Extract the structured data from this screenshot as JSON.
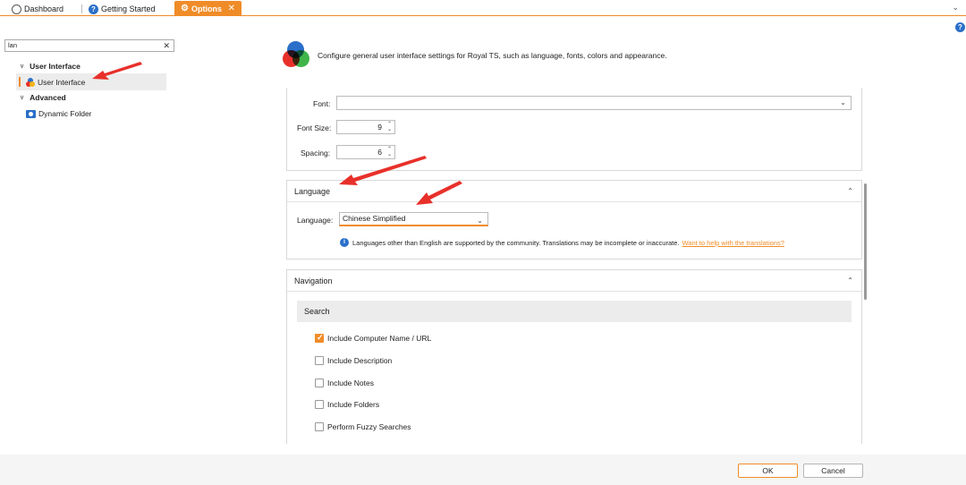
{
  "tabs": {
    "dashboard": "Dashboard",
    "getting_started": "Getting Started",
    "options": "Options"
  },
  "sidebar": {
    "search_value": "lan",
    "groups": [
      {
        "label": "User Interface",
        "items": [
          {
            "label": "User Interface",
            "selected": true
          }
        ]
      },
      {
        "label": "Advanced",
        "items": [
          {
            "label": "Dynamic Folder",
            "selected": false
          }
        ]
      }
    ]
  },
  "header": {
    "description": "Configure general user interface settings for Royal TS, such as language, fonts, colors and appearance."
  },
  "font_section": {
    "font_label": "Font:",
    "font_value": "",
    "font_size_label": "Font Size:",
    "font_size_value": "9",
    "spacing_label": "Spacing:",
    "spacing_value": "6"
  },
  "language_section": {
    "title": "Language",
    "language_label": "Language:",
    "language_value": "Chinese Simplified",
    "info_text": "Languages other than English are supported by the community. Translations may be incomplete or inaccurate.",
    "info_link": "Want to help with the translations?"
  },
  "navigation_section": {
    "title": "Navigation",
    "search_header": "Search",
    "checkboxes": [
      {
        "label": "Include Computer Name / URL",
        "checked": true
      },
      {
        "label": "Include Description",
        "checked": false
      },
      {
        "label": "Include Notes",
        "checked": false
      },
      {
        "label": "Include Folders",
        "checked": false
      },
      {
        "label": "Perform Fuzzy Searches",
        "checked": false
      }
    ]
  },
  "footer": {
    "ok": "OK",
    "cancel": "Cancel"
  },
  "colors": {
    "accent": "#f08c28",
    "info_blue": "#2a6fc9",
    "annotation_arrow": "#e8302a"
  }
}
